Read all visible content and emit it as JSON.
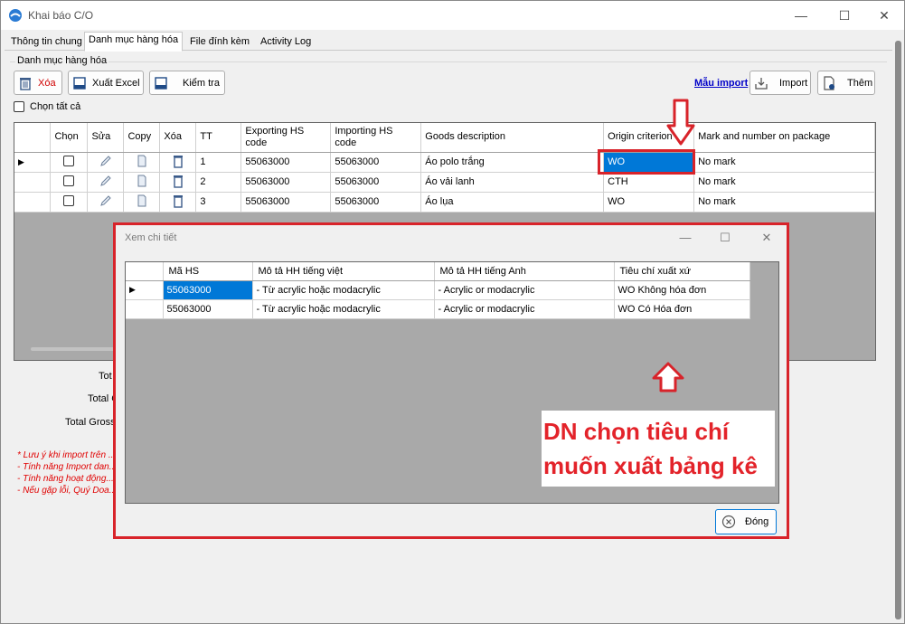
{
  "window": {
    "title": "Khai báo C/O",
    "minimize": "—",
    "maximize": "☐",
    "close": "✕"
  },
  "tabs": [
    "Thông tin chung",
    "Danh mục hàng hóa",
    "File đính kèm",
    "Activity Log"
  ],
  "section_title": "Danh mục hàng hóa",
  "toolbar": {
    "delete": "Xóa",
    "export_excel": "Xuất Excel",
    "check": "Kiểm tra",
    "import_template": "Mẫu import",
    "import": "Import",
    "add": "Thêm"
  },
  "select_all": "Chọn tất cả",
  "main_table": {
    "columns": [
      "Chọn",
      "Sửa",
      "Copy",
      "Xóa",
      "TT",
      "Exporting HS code",
      "Importing HS code",
      "Goods description",
      "Origin criterion",
      "Mark and number on package"
    ],
    "rows": [
      {
        "tt": "1",
        "exp": "55063000",
        "imp": "55063000",
        "desc": "Áo polo trắng",
        "origin": "WO",
        "mark": "No mark"
      },
      {
        "tt": "2",
        "exp": "55063000",
        "imp": "55063000",
        "desc": "Áo vải lanh",
        "origin": "CTH",
        "mark": "No mark"
      },
      {
        "tt": "3",
        "exp": "55063000",
        "imp": "55063000",
        "desc": "Áo lụa",
        "origin": "WO",
        "mark": "No mark"
      }
    ]
  },
  "totals": {
    "t1": "Tot",
    "t2": "Total C",
    "t3": "Total Gross"
  },
  "notes": [
    "* Lưu ý khi import trên ...",
    "- Tính năng Import dan...",
    "- Tính năng hoạt động...",
    "- Nếu gặp lỗi, Quý Doa..."
  ],
  "dialog": {
    "title": "Xem chi tiết",
    "columns": [
      "Mã HS",
      "Mô tả HH tiếng việt",
      "Mô tả HH tiếng Anh",
      "Tiêu chí xuất xứ"
    ],
    "rows": [
      {
        "hs": "55063000",
        "vi": "- Từ acrylic hoặc modacrylic",
        "en": "- Acrylic or modacrylic",
        "criterion": "WO Không hóa đơn"
      },
      {
        "hs": "55063000",
        "vi": "- Từ acrylic hoặc modacrylic",
        "en": "- Acrylic or modacrylic",
        "criterion": "WO Có Hóa đơn"
      }
    ],
    "close_label": "Đóng"
  },
  "callout": {
    "line1": "DN chọn tiêu chí",
    "line2": "muốn xuất bảng kê"
  },
  "colors": {
    "highlight_red": "#d8232a",
    "selection_blue": "#0078d7"
  }
}
